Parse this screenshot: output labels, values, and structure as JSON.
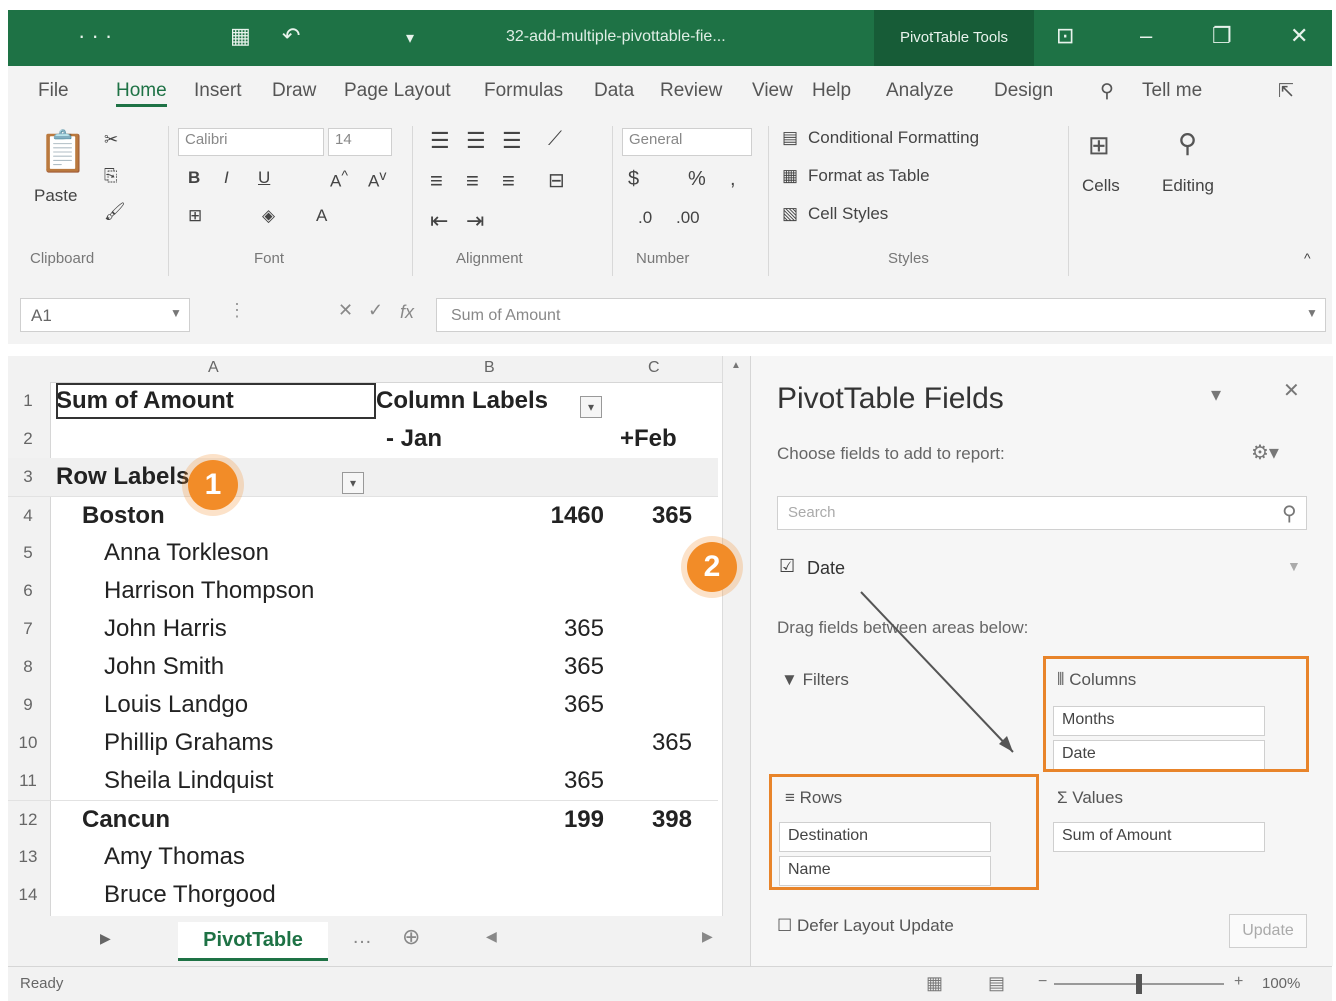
{
  "titlebar": {
    "filename": "32-add-multiple-pivottable-fie...",
    "contextual_tab": "PivotTable Tools"
  },
  "ribbon_tabs": [
    "File",
    "Home",
    "Insert",
    "Draw",
    "Page Layout",
    "Formulas",
    "Data",
    "Review",
    "View",
    "Help",
    "Analyze",
    "Design"
  ],
  "tell_me": "Tell me",
  "ribbon": {
    "clipboard": {
      "label": "Clipboard",
      "paste": "Paste"
    },
    "font": {
      "label": "Font",
      "name": "Calibri",
      "size": "14"
    },
    "alignment": {
      "label": "Alignment"
    },
    "number": {
      "label": "Number",
      "format": "General"
    },
    "styles": {
      "label": "Styles",
      "conditional": "Conditional Formatting",
      "format_table": "Format as Table",
      "cell_styles": "Cell Styles"
    },
    "cells": "Cells",
    "editing": "Editing"
  },
  "formula_bar": {
    "name_box": "A1",
    "formula": "Sum of Amount"
  },
  "grid": {
    "columns": [
      "A",
      "B",
      "C"
    ],
    "header": {
      "corner": "Sum of Amount",
      "col_labels": "Column Labels",
      "row_labels": "Row Labels",
      "jan": "Jan",
      "feb": "Feb"
    },
    "rows": [
      {
        "n": "4",
        "label": "Boston",
        "jan": "1460",
        "feb": "365",
        "bold": true
      },
      {
        "n": "5",
        "label": "Anna Torkleson",
        "jan": "",
        "feb": ""
      },
      {
        "n": "6",
        "label": "Harrison Thompson",
        "jan": "",
        "feb": ""
      },
      {
        "n": "7",
        "label": "John Harris",
        "jan": "365",
        "feb": ""
      },
      {
        "n": "8",
        "label": "John Smith",
        "jan": "365",
        "feb": ""
      },
      {
        "n": "9",
        "label": "Louis Landgo",
        "jan": "365",
        "feb": ""
      },
      {
        "n": "10",
        "label": "Phillip Grahams",
        "jan": "",
        "feb": "365"
      },
      {
        "n": "11",
        "label": "Sheila Lindquist",
        "jan": "365",
        "feb": ""
      },
      {
        "n": "12",
        "label": "Cancun",
        "jan": "199",
        "feb": "398",
        "bold": true
      },
      {
        "n": "13",
        "label": "Amy Thomas",
        "jan": "",
        "feb": ""
      },
      {
        "n": "14",
        "label": "Bruce Thorgood",
        "jan": "",
        "feb": ""
      }
    ]
  },
  "sheet_tab": "PivotTable",
  "pane": {
    "title": "PivotTable Fields",
    "subtitle": "Choose fields to add to report:",
    "search_placeholder": "Search",
    "field_date": "Date",
    "drag_label": "Drag fields between areas below:",
    "filters": "Filters",
    "columns": "Columns",
    "rows": "Rows",
    "values": "Values",
    "columns_items": [
      "Months",
      "Date"
    ],
    "rows_items": [
      "Destination",
      "Name"
    ],
    "values_items": [
      "Sum of Amount"
    ],
    "defer": "Defer Layout Update",
    "update": "Update"
  },
  "badges": [
    "1",
    "2"
  ],
  "status": {
    "ready": "Ready",
    "zoom": "100%"
  },
  "colors": {
    "excel_green": "#1e7245",
    "badge_orange": "#f28c28"
  }
}
